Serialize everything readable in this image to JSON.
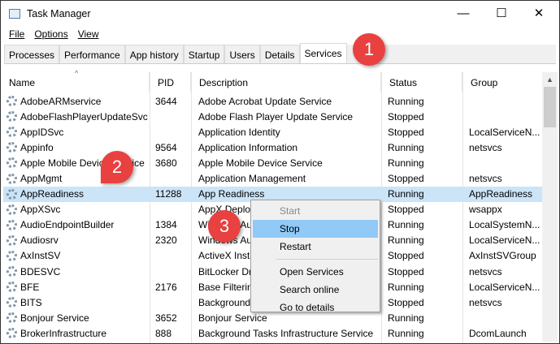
{
  "window": {
    "title": "Task Manager",
    "minimize": "—",
    "maximize": "☐",
    "close": "✕"
  },
  "menu": [
    "File",
    "Options",
    "View"
  ],
  "tabs": [
    "Processes",
    "Performance",
    "App history",
    "Startup",
    "Users",
    "Details",
    "Services"
  ],
  "columns": [
    "Name",
    "PID",
    "Description",
    "Status",
    "Group"
  ],
  "rows": [
    [
      "AdobeARMservice",
      "3644",
      "Adobe Acrobat Update Service",
      "Running",
      ""
    ],
    [
      "AdobeFlashPlayerUpdateSvc",
      "",
      "Adobe Flash Player Update Service",
      "Stopped",
      ""
    ],
    [
      "AppIDSvc",
      "",
      "Application Identity",
      "Stopped",
      "LocalServiceN..."
    ],
    [
      "Appinfo",
      "9564",
      "Application Information",
      "Running",
      "netsvcs"
    ],
    [
      "Apple Mobile Device Service",
      "3680",
      "Apple Mobile Device Service",
      "Running",
      ""
    ],
    [
      "AppMgmt",
      "",
      "Application Management",
      "Stopped",
      "netsvcs"
    ],
    [
      "AppReadiness",
      "11288",
      "App Readiness",
      "Running",
      "AppReadiness"
    ],
    [
      "AppXSvc",
      "",
      "AppX Deployment Service (AppXSVC)",
      "Stopped",
      "wsappx"
    ],
    [
      "AudioEndpointBuilder",
      "1384",
      "Windows Audio Endpoint Builder",
      "Running",
      "LocalSystemN..."
    ],
    [
      "Audiosrv",
      "2320",
      "Windows Audio",
      "Running",
      "LocalServiceN..."
    ],
    [
      "AxInstSV",
      "",
      "ActiveX Installer (AxInstSV)",
      "Stopped",
      "AxInstSVGroup"
    ],
    [
      "BDESVC",
      "",
      "BitLocker Drive Encryption Service",
      "Stopped",
      "netsvcs"
    ],
    [
      "BFE",
      "2176",
      "Base Filtering Engine",
      "Running",
      "LocalServiceN..."
    ],
    [
      "BITS",
      "",
      "Background Intelligent Transfer Service",
      "Stopped",
      "netsvcs"
    ],
    [
      "Bonjour Service",
      "3652",
      "Bonjour Service",
      "Running",
      ""
    ],
    [
      "BrokerInfrastructure",
      "888",
      "Background Tasks Infrastructure Service",
      "Running",
      "DcomLaunch"
    ]
  ],
  "selected_row": 6,
  "context_menu": {
    "items": [
      "Start",
      "Stop",
      "Restart",
      "Open Services",
      "Search online",
      "Go to details"
    ],
    "disabled": "Start",
    "highlighted": "Stop"
  },
  "badges": [
    "1",
    "2",
    "3"
  ],
  "colors": {
    "selection": "#cce4f7",
    "menu_highlight": "#91c9f7",
    "badge": "#e8413f"
  }
}
